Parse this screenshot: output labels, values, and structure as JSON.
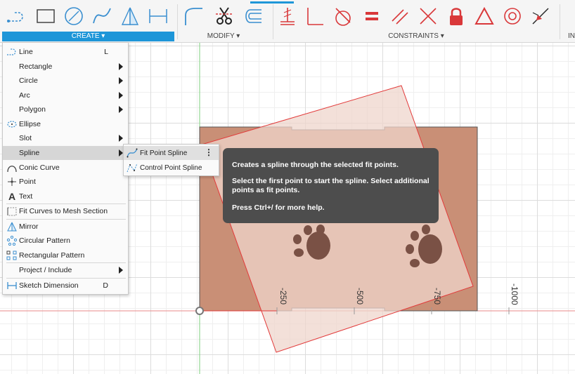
{
  "toolbar": {
    "sections": [
      {
        "label": "CREATE ▾",
        "active": true
      },
      {
        "label": "MODIFY ▾",
        "active": false
      },
      {
        "label": "CONSTRAINTS ▾",
        "active": false
      },
      {
        "label": "IN",
        "active": false
      }
    ],
    "icons": [
      "line-icon",
      "rectangle-icon",
      "circle-icon",
      "spline-icon",
      "mirror-icon",
      "dimension-icon",
      "fillet-icon",
      "trim-icon",
      "offset-icon",
      "coincident-icon",
      "perpendicular-icon",
      "tangent-icon",
      "equal-icon",
      "parallel-icon",
      "angle-icon",
      "fix-icon",
      "triangle-icon",
      "concentric-icon",
      "midpoint-icon"
    ],
    "accent": "#1e96d8",
    "constraint_color": "#d9383a"
  },
  "menu": {
    "items": [
      {
        "label": "Line",
        "shortcut": "L",
        "icon": "line-icon"
      },
      {
        "label": "Rectangle",
        "icon": "",
        "submenu": true
      },
      {
        "label": "Circle",
        "icon": "",
        "submenu": true
      },
      {
        "label": "Arc",
        "icon": "",
        "submenu": true
      },
      {
        "label": "Polygon",
        "icon": "",
        "submenu": true
      },
      {
        "label": "Ellipse",
        "icon": "ellipse-icon"
      },
      {
        "label": "Slot",
        "icon": "",
        "submenu": true
      },
      {
        "label": "Spline",
        "icon": "",
        "submenu": true,
        "selected": true
      },
      {
        "label": "Conic Curve",
        "icon": "conic-curve-icon"
      },
      {
        "label": "Point",
        "icon": "point-icon"
      },
      {
        "label": "Text",
        "icon": "text-icon"
      },
      {
        "label": "Fit Curves to Mesh Section",
        "icon": "fit-curves-icon"
      },
      {
        "label": "Mirror",
        "icon": "mirror-icon"
      },
      {
        "label": "Circular Pattern",
        "icon": "circular-pattern-icon"
      },
      {
        "label": "Rectangular Pattern",
        "icon": "rectangular-pattern-icon"
      },
      {
        "label": "Project / Include",
        "icon": "",
        "submenu": true
      },
      {
        "label": "Sketch Dimension",
        "shortcut": "D",
        "icon": "dimension-icon"
      }
    ]
  },
  "submenu": {
    "items": [
      {
        "label": "Fit Point Spline",
        "icon": "fit-point-spline-icon"
      },
      {
        "label": "Control Point Spline",
        "icon": "control-point-spline-icon"
      }
    ],
    "more_label": "⋮"
  },
  "tooltip": {
    "line1": "Creates a spline through the selected fit points.",
    "line2": "Select the first point to start the spline. Select additional points as fit points.",
    "line3": "Press Ctrl+/ for more help."
  },
  "canvas": {
    "tick_labels": [
      "-250",
      "-500",
      "-750",
      "-1000"
    ]
  }
}
